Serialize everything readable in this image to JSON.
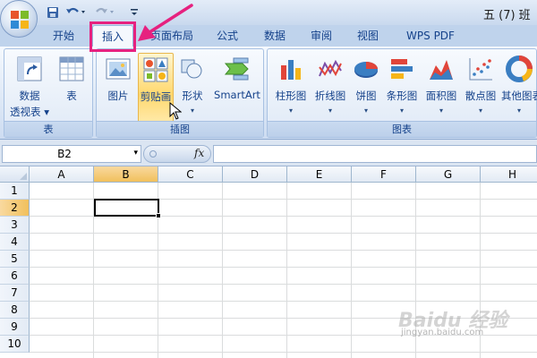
{
  "window": {
    "title": "五 (7) 班"
  },
  "tabs": [
    {
      "key": "home",
      "label": "开始"
    },
    {
      "key": "insert",
      "label": "插入"
    },
    {
      "key": "page_layout",
      "label": "页面布局"
    },
    {
      "key": "formulas",
      "label": "公式"
    },
    {
      "key": "data",
      "label": "数据"
    },
    {
      "key": "review",
      "label": "审阅"
    },
    {
      "key": "view",
      "label": "视图"
    },
    {
      "key": "wps_pdf",
      "label": "WPS PDF"
    }
  ],
  "active_tab": "插入",
  "ribbon": {
    "groups": {
      "tables": {
        "label": "表"
      },
      "illustrations": {
        "label": "插图"
      },
      "charts": {
        "label": "图表"
      }
    },
    "buttons": {
      "pivot_line1": "数据",
      "pivot_line2": "透视表",
      "table": "表",
      "picture": "图片",
      "clipart": "剪贴画",
      "shapes": "形状",
      "smartart": "SmartArt",
      "column": "柱形图",
      "line": "折线图",
      "pie": "饼图",
      "bar": "条形图",
      "area": "面积图",
      "scatter": "散点图",
      "other": "其他图表"
    },
    "dropdown_glyph": "▾"
  },
  "formula_bar": {
    "name_box": "B2",
    "fx_label": "fx",
    "formula": ""
  },
  "grid": {
    "columns": [
      "A",
      "B",
      "C",
      "D",
      "E",
      "F",
      "G",
      "H"
    ],
    "rows": [
      "1",
      "2",
      "3",
      "4",
      "5",
      "6",
      "7",
      "8",
      "9",
      "10"
    ],
    "active_column": "B",
    "active_row": "2"
  },
  "colors": {
    "accent_highlight": "#e6217f",
    "ribbon_blue": "#15428b",
    "active_header": "#f1c05c"
  },
  "watermark": {
    "brand": "Baidu 经验",
    "url": "jingyan.baidu.com"
  }
}
